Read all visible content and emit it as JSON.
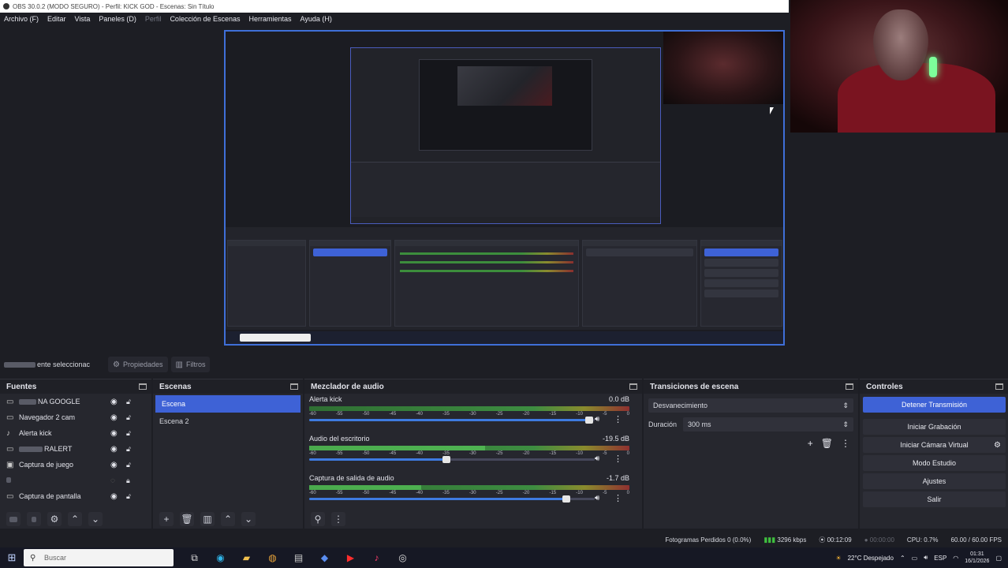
{
  "window": {
    "title": "OBS 30.0.2 (MODO SEGURO) - Perfil: KICK GOD - Escenas: Sin Título"
  },
  "menu": [
    {
      "label": "Archivo (F)",
      "enabled": true
    },
    {
      "label": "Editar",
      "enabled": true
    },
    {
      "label": "Vista",
      "enabled": true
    },
    {
      "label": "Paneles (D)",
      "enabled": true
    },
    {
      "label": "Perfil",
      "enabled": false
    },
    {
      "label": "Colección de Escenas",
      "enabled": true
    },
    {
      "label": "Herramientas",
      "enabled": true
    },
    {
      "label": "Ayuda (H)",
      "enabled": true
    }
  ],
  "toolbar": {
    "no_selection": "ente seleccionac",
    "properties": "Propiedades",
    "filters": "Filtros"
  },
  "sources": {
    "title": "Fuentes",
    "items": [
      {
        "label": "NA GOOGLE",
        "icon": "browser-icon",
        "visible": true,
        "locked": false
      },
      {
        "label": "Navegador 2 cam",
        "icon": "browser-icon",
        "visible": true,
        "locked": false
      },
      {
        "label": "Alerta kick",
        "icon": "audio-icon",
        "visible": true,
        "locked": false
      },
      {
        "label": "RALERT",
        "icon": "browser-icon",
        "visible": true,
        "locked": false
      },
      {
        "label": "Captura de juego",
        "icon": "gamepad-icon",
        "visible": true,
        "locked": false
      },
      {
        "label": "",
        "icon": "audio-icon",
        "visible": false,
        "locked": true
      },
      {
        "label": "Captura de pantalla",
        "icon": "monitor-icon",
        "visible": true,
        "locked": false
      }
    ]
  },
  "scenes": {
    "title": "Escenas",
    "items": [
      {
        "label": "Escena",
        "active": true
      },
      {
        "label": "Escena 2",
        "active": false
      }
    ]
  },
  "mixer": {
    "title": "Mezclador de audio",
    "ticks": [
      "-60",
      "-55",
      "-50",
      "-45",
      "-40",
      "-35",
      "-30",
      "-25",
      "-20",
      "-15",
      "-10",
      "-5",
      "0"
    ],
    "channels": [
      {
        "name": "Alerta kick",
        "db": "0.0 dB",
        "level": 0,
        "volume": 0.98
      },
      {
        "name": "Audio del escritorio",
        "db": "-19.5 dB",
        "level": 0.55,
        "volume": 0.48
      },
      {
        "name": "Captura de salida de audio",
        "db": "-1.7 dB",
        "level": 0.35,
        "volume": 0.9
      }
    ]
  },
  "transitions": {
    "title": "Transiciones de escena",
    "selected": "Desvanecimiento",
    "duration_label": "Duración",
    "duration_value": "300 ms"
  },
  "controls": {
    "title": "Controles",
    "buttons": [
      "Detener Transmisión",
      "Iniciar Grabación",
      "Iniciar Cámara Virtual",
      "Modo Estudio",
      "Ajustes",
      "Salir"
    ]
  },
  "status": {
    "dropped": "Fotogramas Perdidos 0 (0.0%)",
    "bitrate": "3296 kbps",
    "stream_time": "00:12:09",
    "rec_time": "00:00:00",
    "cpu": "CPU: 0.7%",
    "fps": "60.00 / 60.00 FPS"
  },
  "taskbar": {
    "search_placeholder": "Buscar",
    "weather": "22°C  Despejado",
    "lang": "ESP",
    "time": "01:31",
    "date": "16/1/2026"
  },
  "colors": {
    "accent": "#3e62d6",
    "background": "#1d1e24",
    "panel": "#26272e"
  }
}
